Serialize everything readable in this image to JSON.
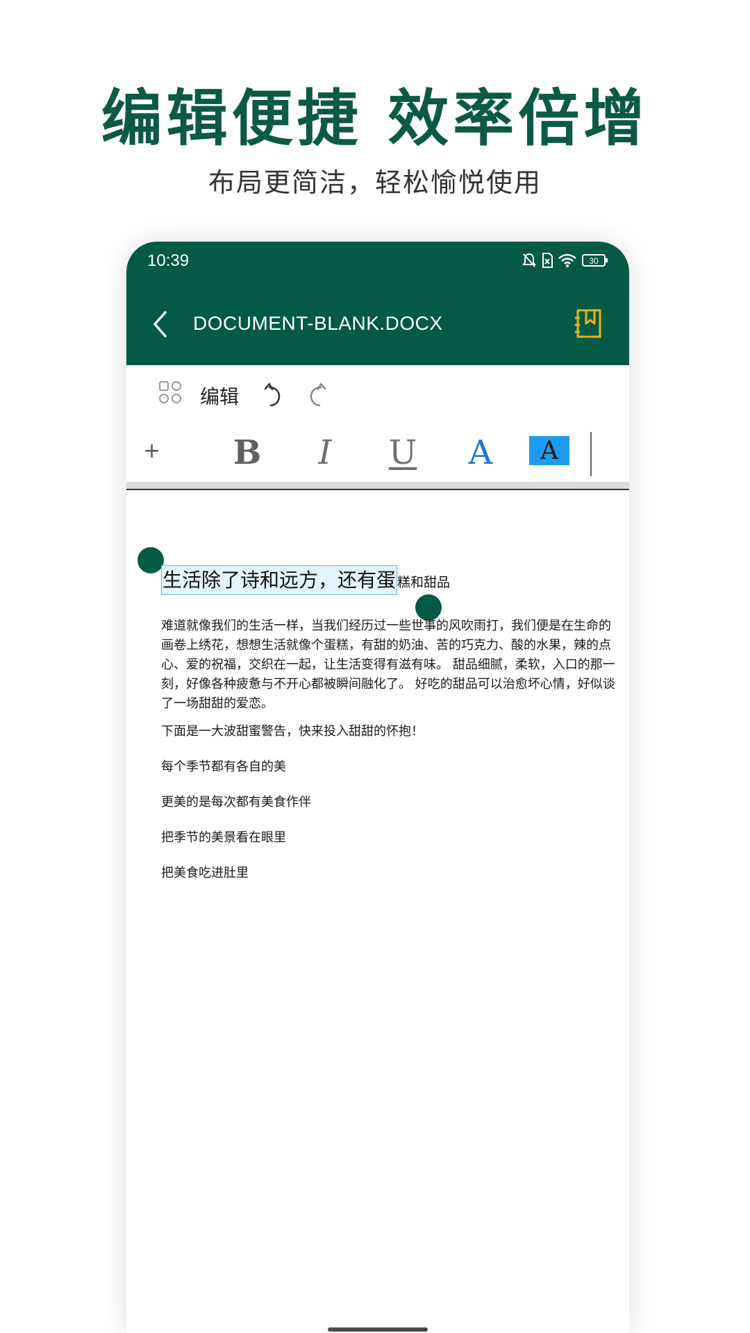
{
  "promo": {
    "headline": "编辑便捷  效率倍增",
    "subline": "布局更简洁，轻松愉悦使用"
  },
  "status_bar": {
    "time": "10:39",
    "battery": "30",
    "icons": [
      "mute-bell-icon",
      "sim-x-icon",
      "wifi-icon",
      "battery-icon"
    ]
  },
  "app_bar": {
    "title": "DOCUMENT-BLANK.DOCX",
    "back_icon": "chevron-left-icon",
    "bookmark_icon": "bookmark-icon"
  },
  "toolbar": {
    "edit_label": "编辑",
    "plus_label": "+",
    "bold_label": "B",
    "italic_label": "I",
    "underline_label": "U",
    "font_color_label": "A",
    "highlight_label": "A"
  },
  "colors": {
    "brand": "#045a44",
    "font_color": "#1e73d8",
    "highlight": "#1e9bf0"
  },
  "document": {
    "heading_selected": "生活除了诗和远方，还有蛋",
    "heading_rest": "糕和甜品",
    "paragraphs": [
      "难道就像我们的生活一样，当我们经历过一些世事的风吹雨打，我们便是在生命的画卷上绣花，想想生活就像个蛋糕，有甜的奶油、苦的巧克力、酸的水果，辣的点心、爱的祝福，交织在一起，让生活变得有滋有味。 甜品细腻，柔软，入口的那一刻，好像各种疲惫与不开心都被瞬间融化了。 好吃的甜品可以治愈坏心情，好似谈了一场甜甜的爱恋。",
      "下面是一大波甜蜜警告，快来投入甜甜的怀抱！",
      "每个季节都有各自的美",
      "更美的是每次都有美食作伴",
      "把季节的美景看在眼里",
      "把美食吃进肚里"
    ]
  }
}
